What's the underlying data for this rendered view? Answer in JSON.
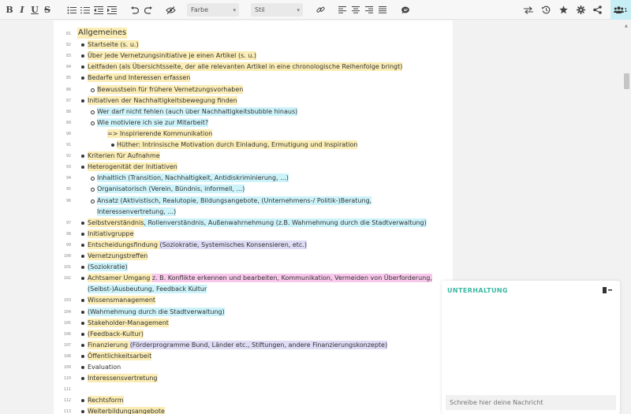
{
  "toolbar": {
    "bold": "B",
    "italic": "I",
    "underline": "U",
    "strike": "S",
    "color_select": "Farbe",
    "style_select": "Stil",
    "users_count": "1"
  },
  "document": {
    "heading": "Allgemeines",
    "lines": [
      {
        "num": "81",
        "type": "heading"
      },
      {
        "num": "82",
        "level": 1,
        "parts": [
          {
            "t": "Startseite (s. u.)",
            "h": "y"
          }
        ]
      },
      {
        "num": "83",
        "level": 1,
        "parts": [
          {
            "t": "Über jede Vernetzungsinitiative je einen Artikel (s. u.)",
            "h": "y"
          }
        ]
      },
      {
        "num": "84",
        "level": 1,
        "parts": [
          {
            "t": "Leitfaden (als Übersichtsseite, der alle relevanten Artikel in eine chronologische Reihenfolge bringt)",
            "h": "y"
          }
        ]
      },
      {
        "num": "85",
        "level": 1,
        "parts": [
          {
            "t": "Bedarfe und Interessen erfassen",
            "h": "y"
          }
        ]
      },
      {
        "num": "86",
        "level": 2,
        "parts": [
          {
            "t": "Bewusstsein für frühere Vernetzungsvorhaben",
            "h": "y"
          }
        ]
      },
      {
        "num": "87",
        "level": 1,
        "parts": [
          {
            "t": "Initiativen der Nachhaltigkeitsbewegung finden",
            "h": "y"
          }
        ]
      },
      {
        "num": "88",
        "level": 2,
        "parts": [
          {
            "t": "Wer darf nicht fehlen (auch über Nachhaltigkeitsbubble hinaus)",
            "h": "c"
          }
        ]
      },
      {
        "num": "89",
        "level": 2,
        "parts": [
          {
            "t": "Wie motiviere ich sie zur Mitarbeit?",
            "h": "c"
          }
        ]
      },
      {
        "num": "90",
        "level": 3,
        "parts": [
          {
            "t": "=> Inspirierende Kommunikation",
            "h": "y"
          }
        ]
      },
      {
        "num": "91",
        "level": 4,
        "parts": [
          {
            "t": "Hüther: Intrinsische Motivation durch Einladung, Ermutigung und Inspiration",
            "h": "y"
          }
        ]
      },
      {
        "num": "92",
        "level": 1,
        "parts": [
          {
            "t": "Kriterien für Aufnahme",
            "h": "y"
          }
        ]
      },
      {
        "num": "93",
        "level": 1,
        "parts": [
          {
            "t": "Heterogenität der Initiativen",
            "h": "y"
          }
        ]
      },
      {
        "num": "94",
        "level": 2,
        "parts": [
          {
            "t": "Inhaltlich (Transition, Nachhaltigkeit, Antidiskriminierung, ...)",
            "h": "c"
          }
        ]
      },
      {
        "num": "95",
        "level": 2,
        "parts": [
          {
            "t": "Organisatorisch (Verein, Bündnis, informell, ...)",
            "h": "c"
          }
        ]
      },
      {
        "num": "96",
        "level": 2,
        "parts": [
          {
            "t": "Ansatz (Aktivistisch, Realutopie, Bildungsangebote, (Unternehmens-/ Politik-)Beratung,",
            "h": "c"
          }
        ]
      },
      {
        "num": "",
        "level": 2,
        "cont": true,
        "parts": [
          {
            "t": "Interessenvertretung, ...)",
            "h": "c"
          }
        ]
      },
      {
        "num": "97",
        "level": 1,
        "parts": [
          {
            "t": "Selbstverständnis",
            "h": "y"
          },
          {
            "t": ", Rollenverständnis, Außenwahrnehmung (z.B. Wahrnehmung durch die Stadtverwaltung)",
            "h": "c"
          }
        ]
      },
      {
        "num": "98",
        "level": 1,
        "parts": [
          {
            "t": "Initiativgruppe",
            "h": "y"
          }
        ]
      },
      {
        "num": "99",
        "level": 1,
        "parts": [
          {
            "t": "Entscheidungsfindung ",
            "h": "y"
          },
          {
            "t": "(Soziokratie, Systemisches Konsensieren, etc.)",
            "h": "v"
          }
        ]
      },
      {
        "num": "100",
        "level": 1,
        "parts": [
          {
            "t": "Vernetzungstreffen",
            "h": "y"
          }
        ]
      },
      {
        "num": "101",
        "level": 1,
        "parts": [
          {
            "t": "(Soziokratie)",
            "h": "c"
          }
        ]
      },
      {
        "num": "102",
        "level": 1,
        "parts": [
          {
            "t": "Achtsamer Umgang ",
            "h": "y"
          },
          {
            "t": "z. B. Konflikte erkennen und bearbeiten, Kommunikation, Vermeiden von Überforderung,",
            "h": "p"
          }
        ]
      },
      {
        "num": "",
        "level": 1,
        "cont": true,
        "parts": [
          {
            "t": "(Selbst-)Ausbeutung, Feedback Kultur",
            "h": "c"
          }
        ]
      },
      {
        "num": "103",
        "level": 1,
        "parts": [
          {
            "t": "Wissensmanagement",
            "h": "y"
          }
        ]
      },
      {
        "num": "104",
        "level": 1,
        "parts": [
          {
            "t": "(Wahrnehmung durch die Stadtverwaltung)",
            "h": "c"
          }
        ]
      },
      {
        "num": "105",
        "level": 1,
        "parts": [
          {
            "t": "Stakeholder-Management",
            "h": "y"
          }
        ]
      },
      {
        "num": "106",
        "level": 1,
        "parts": [
          {
            "t": "(Feedback-Kultur)",
            "h": "y"
          }
        ]
      },
      {
        "num": "107",
        "level": 1,
        "parts": [
          {
            "t": "Finanzierung ",
            "h": "y"
          },
          {
            "t": "(Förderprogramme Bund, Länder etc., Stiftungen, andere Finanzierungskonzepte)",
            "h": "v"
          }
        ]
      },
      {
        "num": "108",
        "level": 1,
        "parts": [
          {
            "t": "Öffentlichkeitsarbeit",
            "h": "y"
          }
        ]
      },
      {
        "num": "109",
        "level": 1,
        "parts": [
          {
            "t": "Evaluation",
            "h": ""
          }
        ]
      },
      {
        "num": "110",
        "level": 1,
        "parts": [
          {
            "t": "Interessensvertretung",
            "h": "y"
          }
        ]
      },
      {
        "num": "111",
        "level": 0,
        "parts": []
      },
      {
        "num": "112",
        "level": 1,
        "parts": [
          {
            "t": "Rechtsform",
            "h": "y"
          }
        ]
      },
      {
        "num": "113",
        "level": 1,
        "parts": [
          {
            "t": "Weiterbildungsangebote",
            "h": "y"
          }
        ]
      }
    ]
  },
  "chat": {
    "title": "UNTERHALTUNG",
    "placeholder": "Schreibe hier deine Nachricht"
  },
  "colors": {
    "highlight_yellow": "#fbedb5",
    "highlight_cyan": "#cdf3fa",
    "highlight_violet": "#dedbf5",
    "highlight_pink": "#f9c9ec",
    "accent_teal": "#3bb7a3"
  }
}
